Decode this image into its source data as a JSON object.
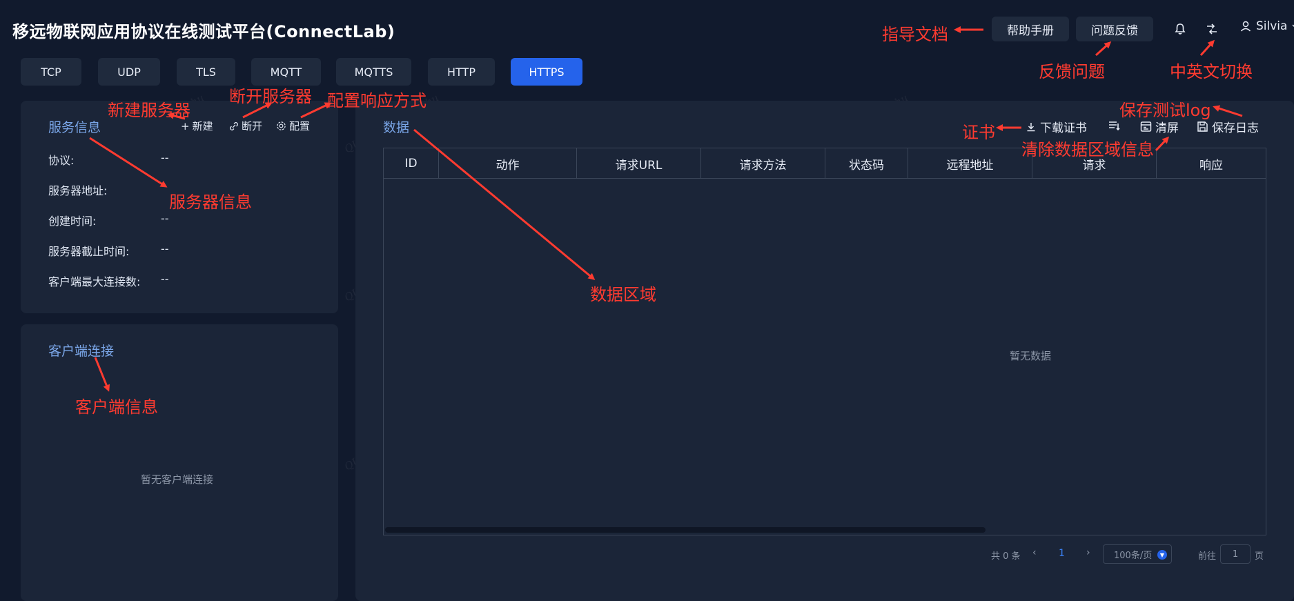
{
  "header": {
    "title": "移远物联网应用协议在线测试平台(ConnectLab)",
    "help_button": "帮助手册",
    "feedback_button": "问题反馈",
    "user_name": "Silvia"
  },
  "tabs": [
    "TCP",
    "UDP",
    "TLS",
    "MQTT",
    "MQTTS",
    "HTTP",
    "HTTPS"
  ],
  "active_tab": "HTTPS",
  "service_panel": {
    "title": "服务信息",
    "new_label": "新建",
    "disconnect_label": "断开",
    "config_label": "配置",
    "fields": [
      {
        "label": "协议:",
        "value": "--"
      },
      {
        "label": "服务器地址:",
        "value": ""
      },
      {
        "label": "创建时间:",
        "value": "--"
      },
      {
        "label": "服务器截止时间:",
        "value": "--"
      },
      {
        "label": "客户端最大连接数:",
        "value": "--"
      }
    ]
  },
  "client_panel": {
    "title": "客户端连接",
    "empty_text": "暂无客户端连接"
  },
  "data_panel": {
    "title": "数据",
    "download_cert_label": "下载证书",
    "clear_label": "清屏",
    "save_log_label": "保存日志",
    "columns": [
      "ID",
      "动作",
      "请求URL",
      "请求方法",
      "状态码",
      "远程地址",
      "请求",
      "响应"
    ],
    "empty_text": "暂无数据"
  },
  "pagination": {
    "total_text": "共 0 条",
    "current_page": "1",
    "page_size": "100条/页",
    "goto_label": "前往",
    "goto_value": "1",
    "page_suffix": "页"
  },
  "annotations": {
    "guide_doc": "指导文档",
    "feedback": "反馈问题",
    "lang_switch": "中英文切换",
    "new_server": "新建服务器",
    "disconnect_server": "断开服务器",
    "config_response": "配置响应方式",
    "server_info": "服务器信息",
    "client_info": "客户端信息",
    "data_area": "数据区域",
    "certificate": "证书",
    "save_log": "保存测试log",
    "clear_data": "清除数据区域信息"
  },
  "watermark_text": "QUECTEL silvia.zhu",
  "colors": {
    "background": "#111a2d",
    "panel": "#1b2538",
    "accent": "#2563eb",
    "title_blue": "#7aa6e8",
    "annotation": "#ff3b30"
  }
}
